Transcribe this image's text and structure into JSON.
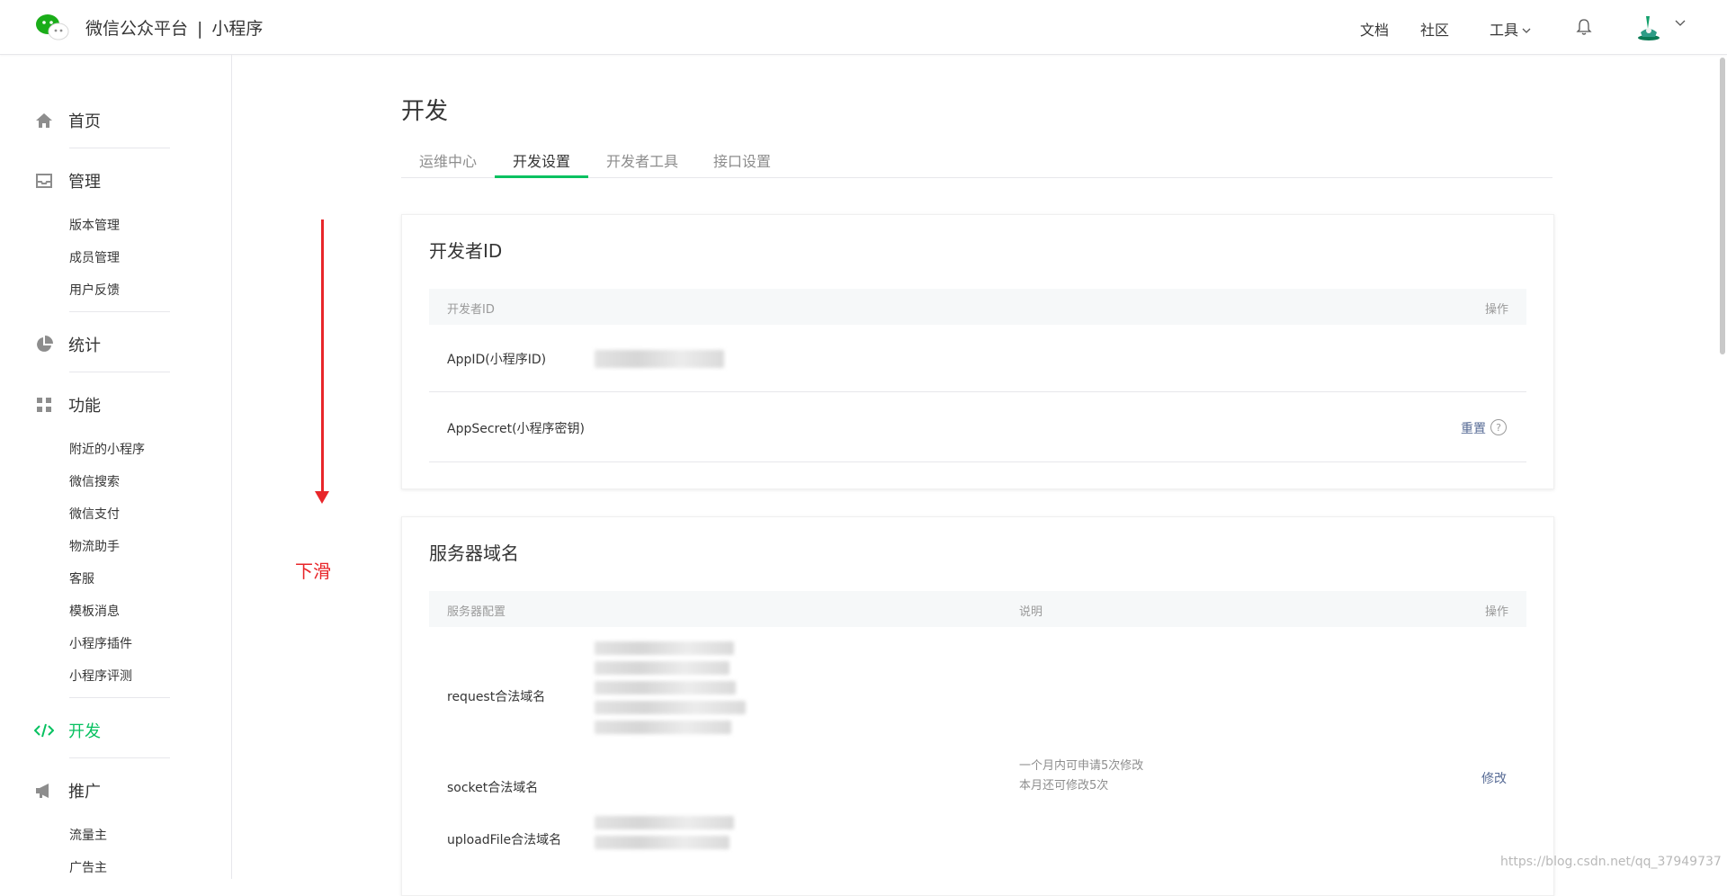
{
  "header": {
    "brand_name": "微信公众平台",
    "separator": "|",
    "product": "小程序",
    "links": {
      "docs": "文档",
      "community": "社区",
      "tools": "工具"
    },
    "icons": [
      "wechat-logo-icon",
      "bell-icon",
      "avatar",
      "chevron-down-icon"
    ]
  },
  "sidebar": {
    "home": "首页",
    "manage": {
      "label": "管理",
      "items": [
        "版本管理",
        "成员管理",
        "用户反馈"
      ]
    },
    "stats": "统计",
    "features": {
      "label": "功能",
      "items": [
        "附近的小程序",
        "微信搜索",
        "微信支付",
        "物流助手",
        "客服",
        "模板消息",
        "小程序插件",
        "小程序评测"
      ]
    },
    "dev": "开发",
    "promo": {
      "label": "推广",
      "items": [
        "流量主",
        "广告主"
      ]
    }
  },
  "main": {
    "title": "开发",
    "tabs": [
      "运维中心",
      "开发设置",
      "开发者工具",
      "接口设置"
    ],
    "active_tab": "开发设置",
    "developer_card": {
      "title": "开发者ID",
      "col_id": "开发者ID",
      "col_action": "操作",
      "appid_label": "AppID(小程序ID)",
      "appsecret_label": "AppSecret(小程序密钥)",
      "reset": "重置",
      "help": "?"
    },
    "server_card": {
      "title": "服务器域名",
      "col_config": "服务器配置",
      "col_desc": "说明",
      "col_action": "操作",
      "rows": [
        "request合法域名",
        "socket合法域名",
        "uploadFile合法域名"
      ],
      "desc_line1": "一个月内可申请5次修改",
      "desc_line2": "本月还可修改5次",
      "modify": "修改"
    }
  },
  "annotation": {
    "text": "下滑"
  },
  "watermark": "https://blog.csdn.net/qq_37949737",
  "colors": {
    "accent": "#07c160",
    "link": "#576b95",
    "annotation": "#e8262a"
  }
}
